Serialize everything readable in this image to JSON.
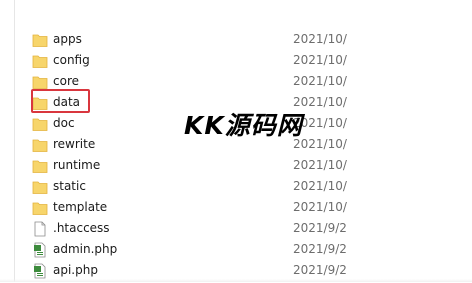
{
  "files": [
    {
      "name": "apps",
      "date": "2021/10/",
      "type": "folder"
    },
    {
      "name": "config",
      "date": "2021/10/",
      "type": "folder"
    },
    {
      "name": "core",
      "date": "2021/10/",
      "type": "folder"
    },
    {
      "name": "data",
      "date": "2021/10/",
      "type": "folder",
      "highlighted": true
    },
    {
      "name": "doc",
      "date": "2021/10/",
      "type": "folder"
    },
    {
      "name": "rewrite",
      "date": "2021/10/",
      "type": "folder"
    },
    {
      "name": "runtime",
      "date": "2021/10/",
      "type": "folder"
    },
    {
      "name": "static",
      "date": "2021/10/",
      "type": "folder"
    },
    {
      "name": "template",
      "date": "2021/10/",
      "type": "folder"
    },
    {
      "name": ".htaccess",
      "date": "2021/9/2",
      "type": "file"
    },
    {
      "name": "admin.php",
      "date": "2021/9/2",
      "type": "php"
    },
    {
      "name": "api.php",
      "date": "2021/9/2",
      "type": "php"
    }
  ],
  "watermark": "KK源码网",
  "colors": {
    "folder": "#f7d56b",
    "folder_dark": "#e3b23c",
    "highlight": "#d9363e",
    "php_green": "#3d8b3d"
  }
}
